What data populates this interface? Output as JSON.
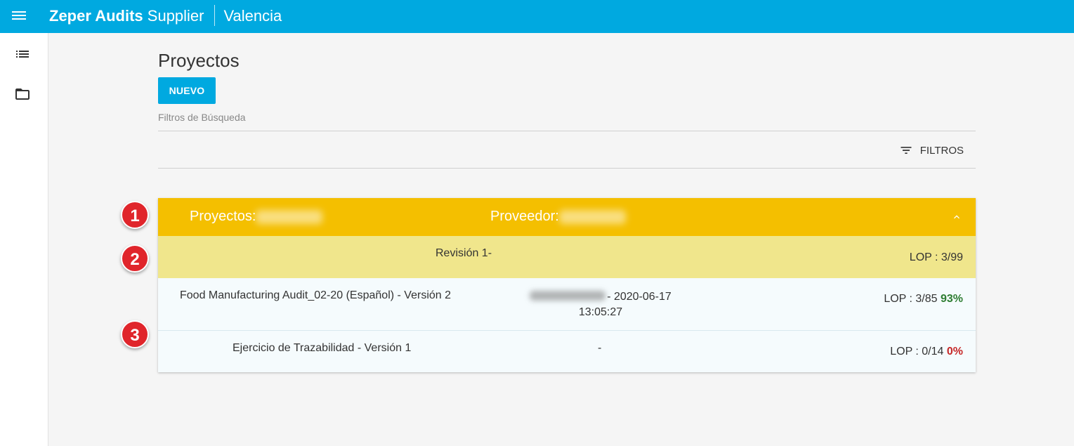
{
  "app": {
    "brand_bold": "Zeper Audits",
    "brand_light": "Supplier",
    "location": "Valencia",
    "accent_color": "#00a9e0"
  },
  "sidebar": {
    "items": [
      {
        "icon": "list-icon"
      },
      {
        "icon": "folder-icon"
      }
    ]
  },
  "main": {
    "title": "Proyectos",
    "new_button": "NUEVO",
    "filters_section_label": "Filtros de Búsqueda",
    "filters_button": "FILTROS"
  },
  "card": {
    "header_color": "#f4bf00",
    "project_label": "Proyectos:",
    "supplier_label": "Proveedor:",
    "revision": {
      "title": "Revisión 1-",
      "lop": "LOP : 3/99",
      "color": "#f0e68c"
    },
    "rows": [
      {
        "name": "Food Manufacturing Audit_02-20 (Español) - Versión 2",
        "date": "- 2020-06-17",
        "time": "13:05:27",
        "lop": "LOP : 3/85",
        "percent": "93%"
      },
      {
        "name": "Ejercicio de Trazabilidad - Versión 1",
        "date": "-",
        "lop": "LOP : 0/14",
        "percent": "0%"
      }
    ]
  },
  "markers": [
    "1",
    "2",
    "3"
  ]
}
